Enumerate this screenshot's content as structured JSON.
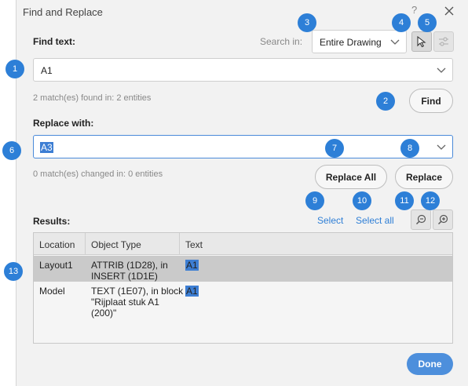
{
  "window": {
    "title": "Find and Replace",
    "help": "?"
  },
  "find": {
    "label": "Find text:",
    "value": "A1",
    "status": "2 match(es) found in: 2 entities",
    "button": "Find"
  },
  "search_in": {
    "label": "Search in:",
    "value": "Entire Drawing"
  },
  "replace": {
    "label": "Replace with:",
    "value": "A3",
    "status": "0 match(es) changed in: 0 entities",
    "replace_all_button": "Replace All",
    "replace_button": "Replace"
  },
  "results": {
    "label": "Results:",
    "select_link": "Select",
    "select_all_link": "Select all",
    "columns": [
      "Location",
      "Object Type",
      "Text"
    ],
    "rows": [
      {
        "location": "Layout1",
        "object_type_lines": [
          "ATTRIB (1D28), in",
          "INSERT (1D1E)"
        ],
        "text": "A1",
        "selected": true
      },
      {
        "location": "Model",
        "object_type_lines": [
          "TEXT (1E07), in block",
          "\"Rijplaat stuk A1",
          "(200)\""
        ],
        "text": "A1",
        "selected": false
      }
    ]
  },
  "footer": {
    "done": "Done"
  },
  "icons": {
    "select_objects": "cursor-arrow-icon",
    "options": "settings-sliders-icon",
    "zoom_out": "zoom-out-icon",
    "zoom_in": "zoom-in-icon"
  },
  "callouts": [
    "1",
    "2",
    "3",
    "4",
    "5",
    "6",
    "7",
    "8",
    "9",
    "10",
    "11",
    "12",
    "13"
  ],
  "colors": {
    "accent": "#2d7fd7",
    "selection": "#3d7ed3",
    "selected_row": "#cacaca"
  }
}
